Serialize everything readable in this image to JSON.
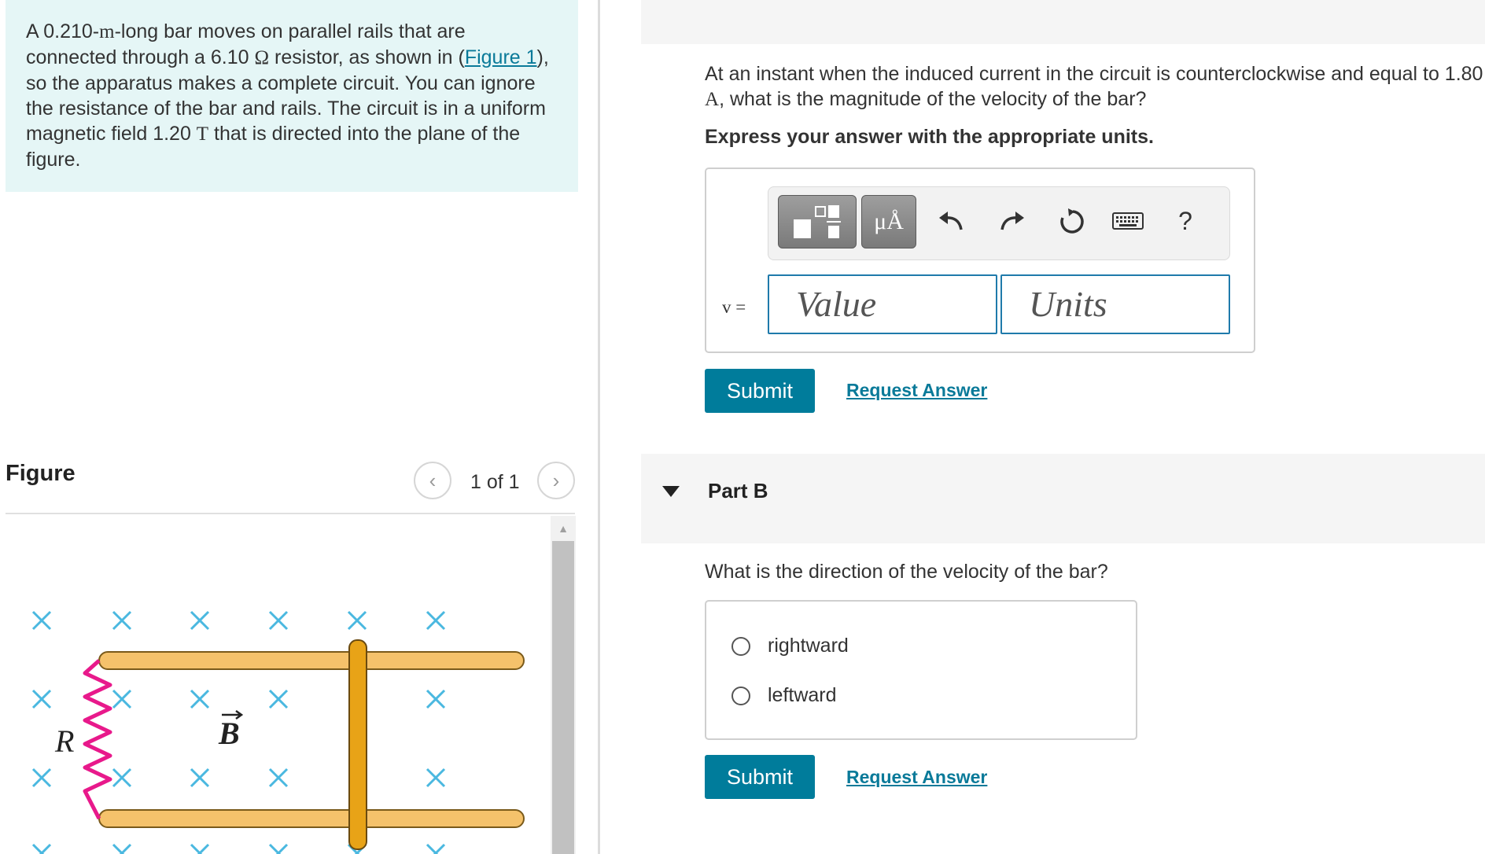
{
  "problem": {
    "t1": "A 0.210-",
    "m1": "m",
    "t2": "-long bar moves on parallel rails that are connected through a 6.10 ",
    "ohm": "Ω",
    "t3": " resistor, as shown in (",
    "figure_link": "Figure 1",
    "t4": "), so the apparatus makes a complete circuit. You can ignore the resistance of the bar and rails. The circuit is in a uniform magnetic field 1.20 ",
    "tesla": "T",
    "t5": " that is directed into the plane of the figure."
  },
  "figure": {
    "label": "Figure",
    "page": "1 of 1",
    "prev_icon": "chevron-left-icon",
    "next_icon": "chevron-right-icon",
    "resistor_label": "R",
    "field_label": "B"
  },
  "part_a": {
    "q1": "At an instant when the induced current in the circuit is counterclockwise and equal to 1.80 ",
    "amp": "A",
    "q2": ", what is the magnitude of the velocity of the bar?",
    "instruction": "Express your answer with the appropriate units.",
    "units_button": "μÅ",
    "help": "?",
    "var_label": "v =",
    "value_placeholder": "Value",
    "units_placeholder": "Units",
    "submit": "Submit",
    "request": "Request Answer"
  },
  "part_b": {
    "title": "Part B",
    "question": "What is the direction of the velocity of the bar?",
    "choices": [
      "rightward",
      "leftward"
    ],
    "submit": "Submit",
    "request": "Request Answer"
  },
  "colors": {
    "accent": "#007c9b",
    "link": "#0a7a99",
    "problem_bg": "#e5f6f6",
    "rail": "#f5c26b",
    "bar": "#e8a317",
    "resistor": "#e8198b",
    "cross": "#4ab8e0"
  }
}
